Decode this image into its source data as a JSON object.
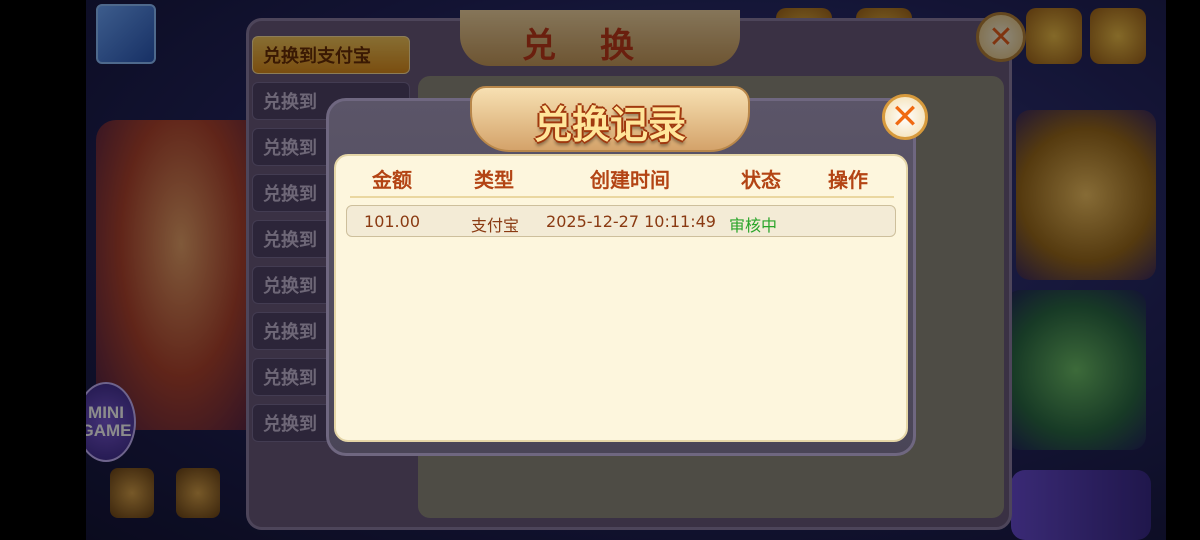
{
  "background": {
    "exchange_title": "兑换",
    "exchange_tab_active": "兑换到支付宝",
    "exchange_tabs": [
      "兑换到",
      "兑换到",
      "兑换到",
      "兑换到",
      "兑换到",
      "兑换到",
      "兑换到",
      "兑换到"
    ],
    "mini_game_label": "MINI GAME"
  },
  "dialog": {
    "title": "兑换记录",
    "close_icon": "close-x-icon",
    "columns": {
      "amount": "金额",
      "type": "类型",
      "created_time": "创建时间",
      "status": "状态",
      "action": "操作"
    },
    "records": [
      {
        "amount": "101.00",
        "type": "支付宝",
        "created_time": "2025-12-27 10:11:49",
        "status": "审核中",
        "action": ""
      }
    ]
  },
  "colors": {
    "header_text": "#b34414",
    "row_text": "#8a3a12",
    "status_pending": "#2aa52a",
    "body_bg": "#fdf6dd"
  }
}
